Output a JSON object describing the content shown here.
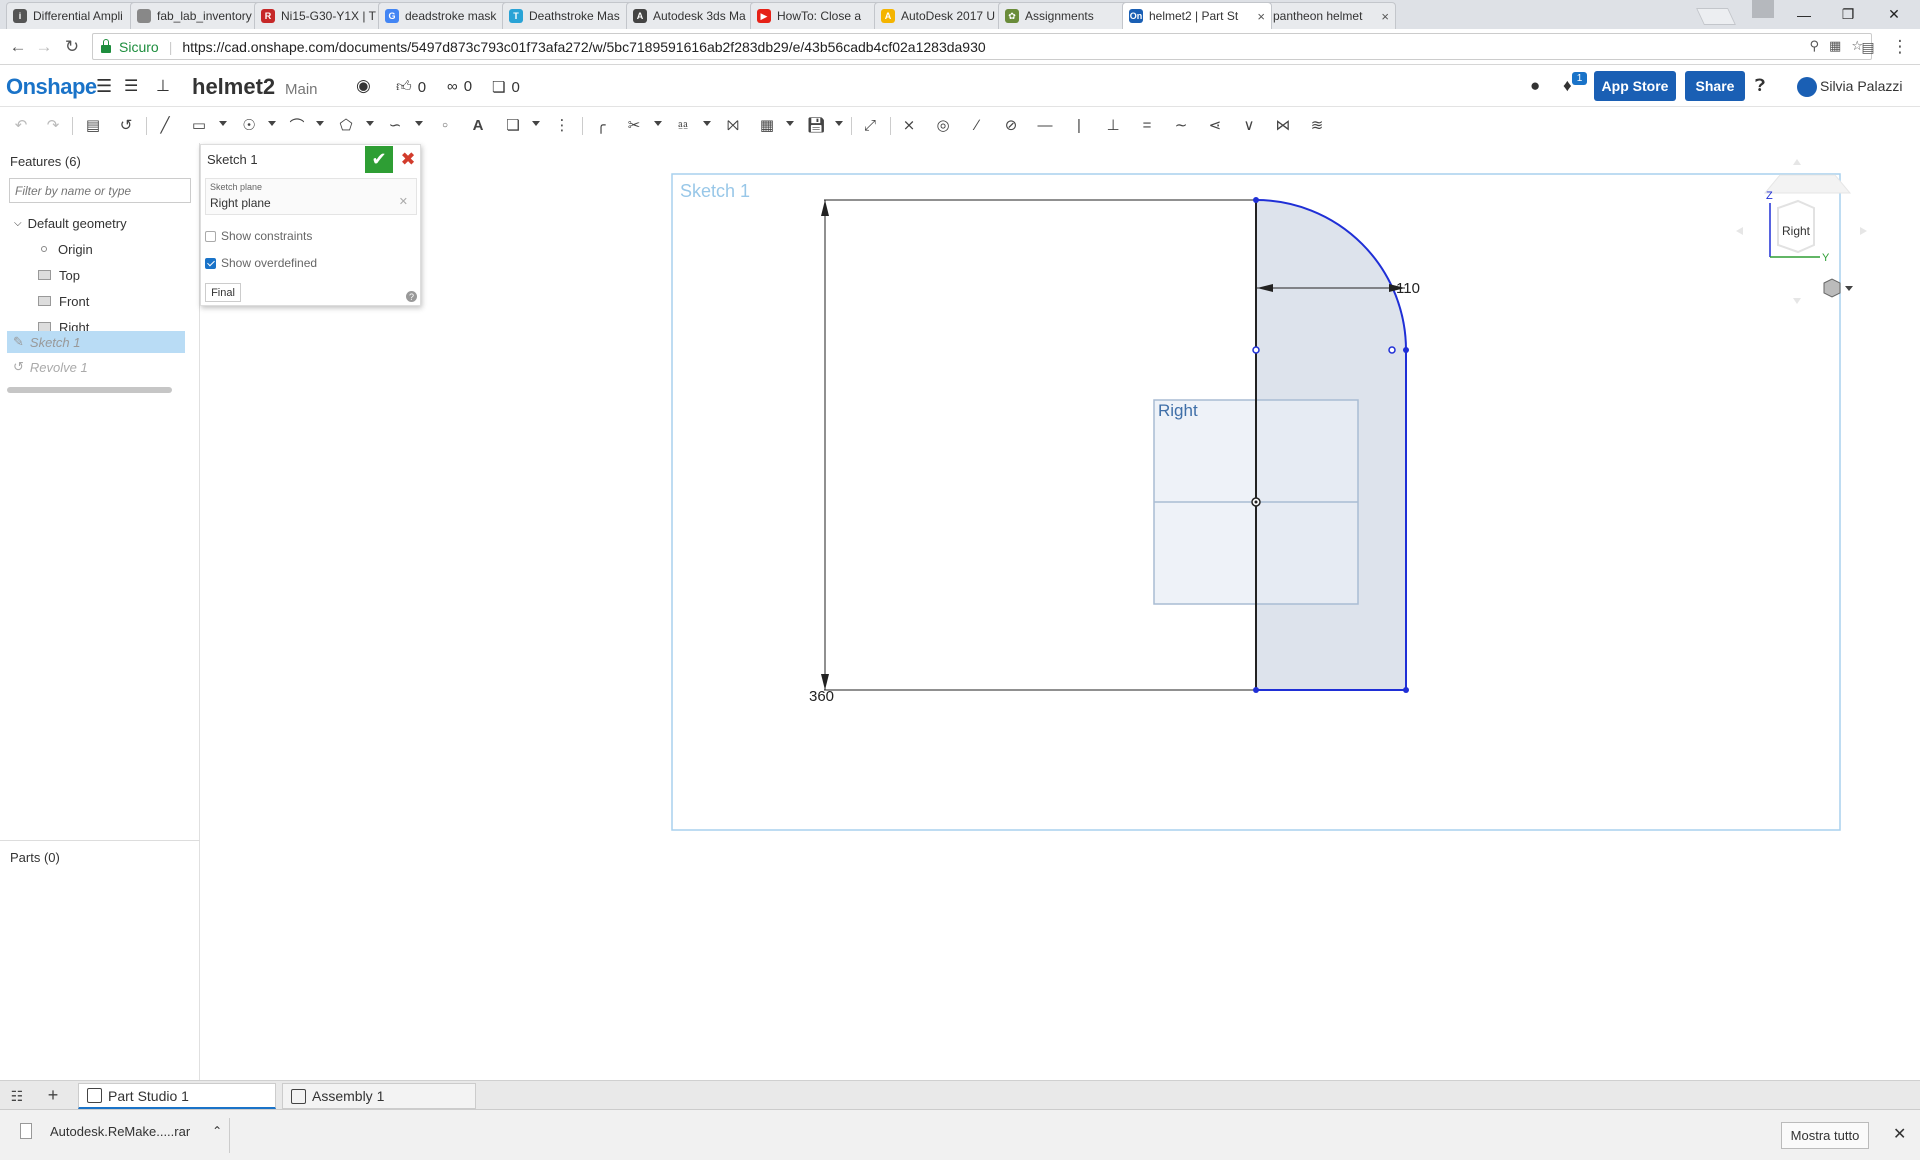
{
  "browser": {
    "tabs": [
      {
        "label": "Differential Ampli",
        "color": "#555555",
        "glyph": "i"
      },
      {
        "label": "fab_lab_inventory",
        "color": "#888888",
        "glyph": ""
      },
      {
        "label": "Ni15-G30-Y1X | T",
        "color": "#c62828",
        "glyph": "R"
      },
      {
        "label": "deadstroke mask",
        "color": "#4285f4",
        "glyph": "G"
      },
      {
        "label": "Deathstroke Mas",
        "color": "#29a3d6",
        "glyph": "T"
      },
      {
        "label": "Autodesk 3ds Ma",
        "color": "#444444",
        "glyph": "A"
      },
      {
        "label": "HowTo: Close a",
        "color": "#e62117",
        "glyph": "▶"
      },
      {
        "label": "AutoDesk 2017 U",
        "color": "#f4b400",
        "glyph": "A"
      },
      {
        "label": "Assignments",
        "color": "#6a8c3a",
        "glyph": "✿"
      },
      {
        "label": "helmet2 | Part St",
        "color": "#1a5fb4",
        "glyph": "On"
      },
      {
        "label": "pantheon helmet",
        "color": "#4285f4",
        "glyph": "G"
      }
    ],
    "active_tab": 9,
    "secure_label": "Sicuro",
    "url": "https://cad.onshape.com/documents/5497d873c793c01f73afa272/w/5bc7189591616ab2f283db29/e/43b56cadb4cf02a1283da930"
  },
  "header": {
    "logo": "Onshape",
    "doc_title": "helmet2",
    "branch": "Main",
    "likes": "0",
    "links": "0",
    "copies": "0",
    "notification_count": "1",
    "app_store_label": "App Store",
    "share_label": "Share",
    "user_name": "Silvia Palazzi"
  },
  "features": {
    "title": "Features (6)",
    "filter_placeholder": "Filter by name or type",
    "default_geometry": "Default geometry",
    "items": [
      "Origin",
      "Top",
      "Front",
      "Right"
    ],
    "sketch": "Sketch 1",
    "revolve": "Revolve 1",
    "parts_title": "Parts (0)"
  },
  "sketch_dialog": {
    "title": "Sketch 1",
    "plane_label": "Sketch plane",
    "plane_value": "Right plane",
    "show_constraints": "Show constraints",
    "show_overdefined": "Show overdefined",
    "final_label": "Final"
  },
  "canvas": {
    "sketch_label": "Sketch 1",
    "plane_label": "Right",
    "dim_height": "360",
    "dim_width": "110",
    "viewcube_label": "Right",
    "axis_z": "Z",
    "axis_y": "Y",
    "colors": {
      "sketch_blue": "#1f2fd6",
      "frame": "#a8d1ee",
      "plane_fill": "#e8eef5",
      "region_fill": "#dde3ec"
    }
  },
  "bottom_tabs": {
    "part_studio": "Part Studio 1",
    "assembly": "Assembly 1"
  },
  "download_bar": {
    "file": "Autodesk.ReMake.....rar",
    "show_all": "Mostra tutto"
  }
}
